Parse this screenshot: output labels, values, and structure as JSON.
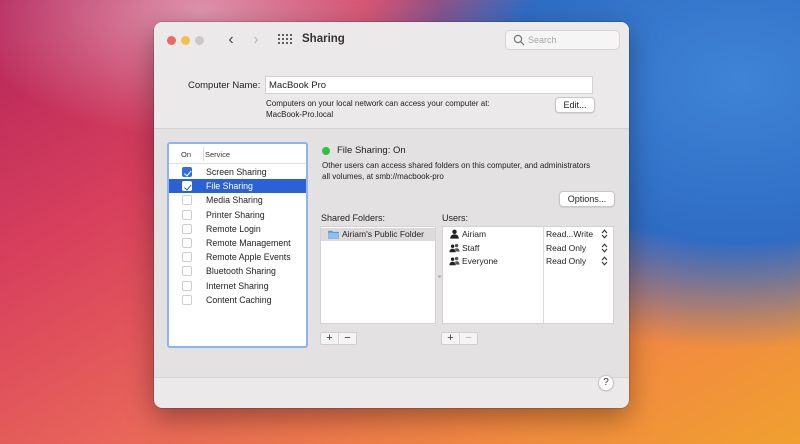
{
  "window": {
    "title": "Sharing",
    "search_placeholder": "Search"
  },
  "computer_name": {
    "label": "Computer Name:",
    "value": "MacBook Pro",
    "description_line1": "Computers on your local network can access your computer at:",
    "description_line2": "MacBook-Pro.local",
    "edit_label": "Edit..."
  },
  "services": {
    "header_on": "On",
    "header_service": "Service",
    "items": [
      {
        "name": "Screen Sharing",
        "checked": true,
        "selected": false
      },
      {
        "name": "File Sharing",
        "checked": true,
        "selected": true
      },
      {
        "name": "Media Sharing",
        "checked": false,
        "selected": false
      },
      {
        "name": "Printer Sharing",
        "checked": false,
        "selected": false
      },
      {
        "name": "Remote Login",
        "checked": false,
        "selected": false
      },
      {
        "name": "Remote Management",
        "checked": false,
        "selected": false
      },
      {
        "name": "Remote Apple Events",
        "checked": false,
        "selected": false
      },
      {
        "name": "Bluetooth Sharing",
        "checked": false,
        "selected": false
      },
      {
        "name": "Internet Sharing",
        "checked": false,
        "selected": false
      },
      {
        "name": "Content Caching",
        "checked": false,
        "selected": false
      }
    ]
  },
  "file_sharing": {
    "status": "File Sharing: On",
    "status_color": "#2fc242",
    "description_line1": "Other users can access shared folders on this computer, and administrators",
    "description_line2": "all volumes, at smb://macbook-pro",
    "options_label": "Options...",
    "shared_folders_label": "Shared Folders:",
    "users_label": "Users:",
    "folders": [
      {
        "name": "Airiam's Public Folder",
        "icon": "folder-icon"
      }
    ],
    "users": [
      {
        "name": "Airiam",
        "permission": "Read...Write",
        "icon": "person-icon"
      },
      {
        "name": "Staff",
        "permission": "Read Only",
        "icon": "group-icon"
      },
      {
        "name": "Everyone",
        "permission": "Read Only",
        "icon": "group-icon"
      }
    ],
    "add_label": "+",
    "remove_label": "−"
  },
  "help_label": "?",
  "colors": {
    "accent": "#2a62d6",
    "close": "#ed6a5e",
    "minimize": "#f5bf4f"
  }
}
